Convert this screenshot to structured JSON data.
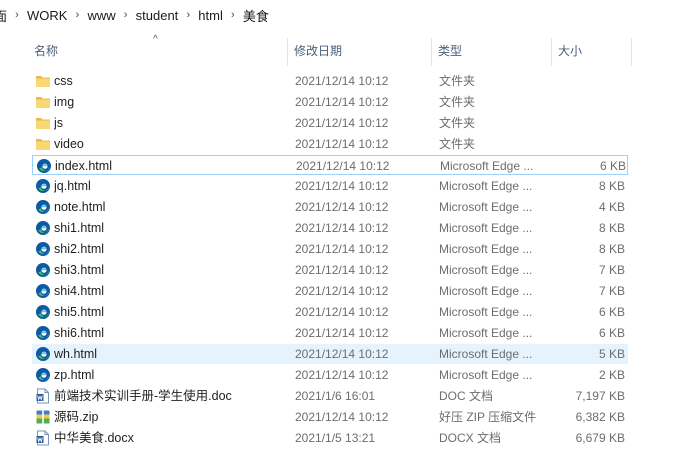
{
  "breadcrumb": [
    "面",
    "WORK",
    "www",
    "student",
    "html",
    "美食"
  ],
  "columns": {
    "name": "名称",
    "date": "修改日期",
    "type": "类型",
    "size": "大小"
  },
  "sort_glyph": "^",
  "files": [
    {
      "name": "css",
      "date": "2021/12/14 10:12",
      "type": "文件夹",
      "size": "",
      "icon": "folder-icon"
    },
    {
      "name": "img",
      "date": "2021/12/14 10:12",
      "type": "文件夹",
      "size": "",
      "icon": "folder-icon"
    },
    {
      "name": "js",
      "date": "2021/12/14 10:12",
      "type": "文件夹",
      "size": "",
      "icon": "folder-icon"
    },
    {
      "name": "video",
      "date": "2021/12/14 10:12",
      "type": "文件夹",
      "size": "",
      "icon": "folder-icon"
    },
    {
      "name": "index.html",
      "date": "2021/12/14 10:12",
      "type": "Microsoft Edge ...",
      "size": "6 KB",
      "icon": "edge-icon",
      "state": "focused"
    },
    {
      "name": "jq.html",
      "date": "2021/12/14 10:12",
      "type": "Microsoft Edge ...",
      "size": "8 KB",
      "icon": "edge-icon"
    },
    {
      "name": "note.html",
      "date": "2021/12/14 10:12",
      "type": "Microsoft Edge ...",
      "size": "4 KB",
      "icon": "edge-icon"
    },
    {
      "name": "shi1.html",
      "date": "2021/12/14 10:12",
      "type": "Microsoft Edge ...",
      "size": "8 KB",
      "icon": "edge-icon"
    },
    {
      "name": "shi2.html",
      "date": "2021/12/14 10:12",
      "type": "Microsoft Edge ...",
      "size": "8 KB",
      "icon": "edge-icon"
    },
    {
      "name": "shi3.html",
      "date": "2021/12/14 10:12",
      "type": "Microsoft Edge ...",
      "size": "7 KB",
      "icon": "edge-icon"
    },
    {
      "name": "shi4.html",
      "date": "2021/12/14 10:12",
      "type": "Microsoft Edge ...",
      "size": "7 KB",
      "icon": "edge-icon"
    },
    {
      "name": "shi5.html",
      "date": "2021/12/14 10:12",
      "type": "Microsoft Edge ...",
      "size": "6 KB",
      "icon": "edge-icon"
    },
    {
      "name": "shi6.html",
      "date": "2021/12/14 10:12",
      "type": "Microsoft Edge ...",
      "size": "6 KB",
      "icon": "edge-icon"
    },
    {
      "name": "wh.html",
      "date": "2021/12/14 10:12",
      "type": "Microsoft Edge ...",
      "size": "5 KB",
      "icon": "edge-icon",
      "state": "selected"
    },
    {
      "name": "zp.html",
      "date": "2021/12/14 10:12",
      "type": "Microsoft Edge ...",
      "size": "2 KB",
      "icon": "edge-icon"
    },
    {
      "name": "前端技术实训手册-学生使用.doc",
      "date": "2021/1/6 16:01",
      "type": "DOC 文档",
      "size": "7,197 KB",
      "icon": "word-doc-icon"
    },
    {
      "name": "源码.zip",
      "date": "2021/12/14 10:12",
      "type": "好压 ZIP 压缩文件",
      "size": "6,382 KB",
      "icon": "zip-archive-icon"
    },
    {
      "name": "中华美食.docx",
      "date": "2021/1/5 13:21",
      "type": "DOCX 文档",
      "size": "6,679 KB",
      "icon": "word-docx-icon"
    }
  ],
  "colors": {
    "header_text": "#4c607a",
    "selected_bg": "#e5f3ff",
    "focus_border": "#99d1ff",
    "folder": "#f8d775",
    "edge_blue": "#0c59a4",
    "edge_green": "#43c05a"
  }
}
